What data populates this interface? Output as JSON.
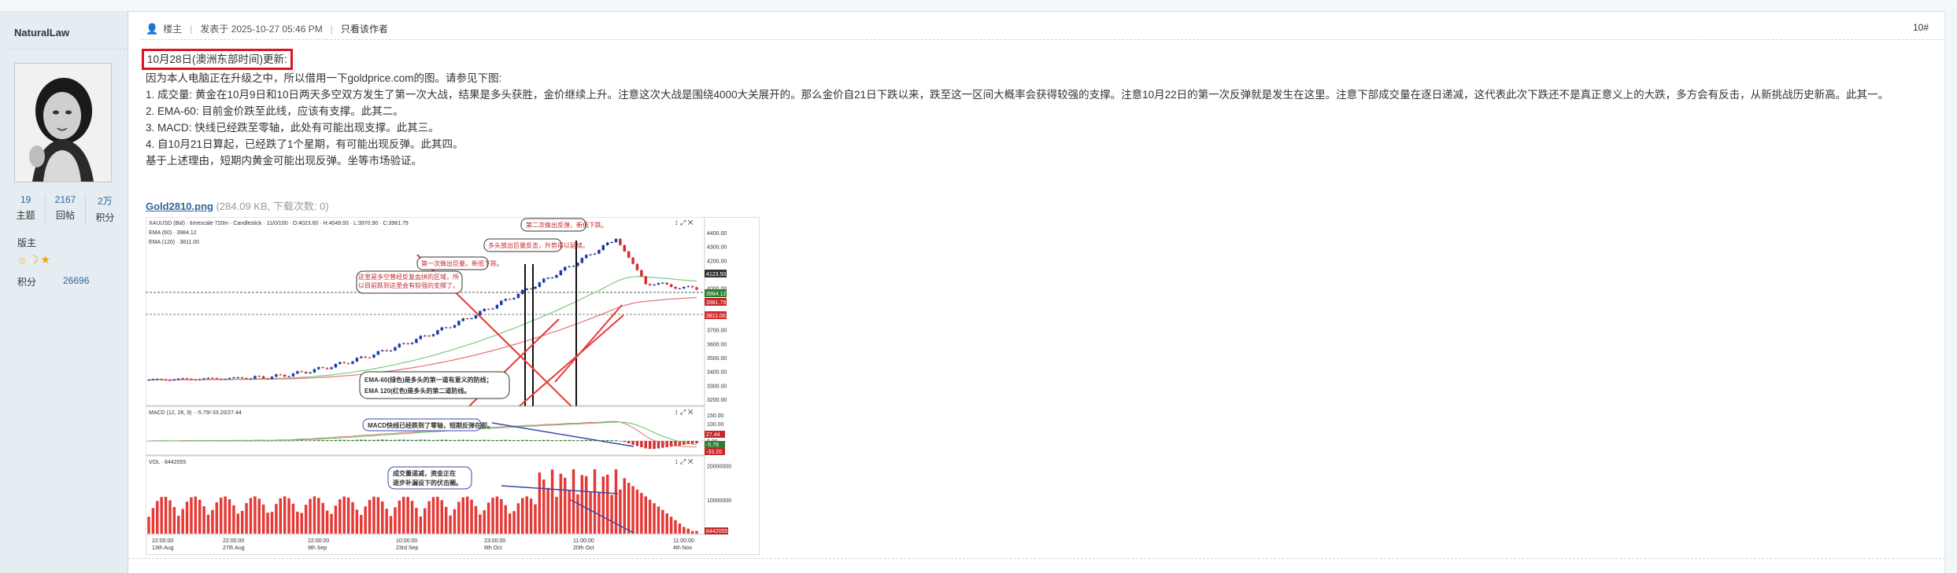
{
  "author": {
    "name": "NaturalLaw",
    "stats": [
      {
        "value": "19",
        "label": "主题"
      },
      {
        "value": "2167",
        "label": "回帖"
      },
      {
        "value": "2万",
        "label": "积分"
      }
    ],
    "group": "版主",
    "credit_label": "积分",
    "credit_value": "26696"
  },
  "post": {
    "owner_label": "楼主",
    "posted_at": "发表于 2025-10-27 05:46 PM",
    "only_author": "只看该作者",
    "floor": "10#",
    "heading": "10月28日(澳洲东部时间)更新:",
    "lines": [
      "因为本人电脑正在升级之中，所以借用一下goldprice.com的图。请参见下图:",
      "1. 成交量: 黄金在10月9日和10日两天多空双方发生了第一次大战，结果是多头获胜，金价继续上升。注意这次大战是围绕4000大关展开的。那么金价自21日下跌以来，跌至这一区间大概率会获得较强的支撑。注意10月22日的第一次反弹就是发生在这里。注意下部成交量在逐日递减，这代表此次下跌还不是真正意义上的大跌，多方会有反击，从新挑战历史新高。此其一。",
      "2. EMA-60: 目前金价跌至此线，应该有支撑。此其二。",
      "3. MACD: 快线已经跌至零轴，此处有可能出现支撑。此其三。",
      "4. 自10月21日算起，已经跌了1个星期，有可能出现反弹。此其四。",
      "基于上述理由，短期内黄金可能出现反弹。坐等市场验证。"
    ],
    "attachment": {
      "name": "Gold2810.png",
      "info": "(284.09 KB, 下载次数: 0)"
    }
  },
  "chart": {
    "header": "XAUUSD (Bid) · timescale 720m · Candlestick · 11/0/100 · O:4023.60 · H:4049.93 · L:3970.90 · C:3981.79",
    "ema60": "EMA (60) · 3984.12",
    "ema120": "EMA (120) · 3811.00",
    "macd_label": "MACD (12, 26, 9) · -5.79/-33.20/27.44",
    "vol_label": "VOL · 8442055",
    "price_ticks": [
      "4400.00",
      "4300.00",
      "4200.00",
      "4100.00",
      "4000.00",
      "3900.00",
      "3800.00",
      "3700.00",
      "3600.00",
      "3500.00",
      "3400.00",
      "3300.00",
      "3200.00"
    ],
    "tag_4123": "4123.50",
    "tag_3984": "3984.12",
    "tag_3981": "3981.79",
    "tag_3811": "3811.00",
    "macd_ticks": [
      "150.00",
      "100.00",
      "50.00",
      "0.00"
    ],
    "tag_27": "27.44",
    "tag_5": "-5.79",
    "tag_33": "-33.20",
    "vol_ticks": [
      "20000000",
      "10000000"
    ],
    "tag_vol": "8442055",
    "dates": [
      {
        "t": "22:00:00",
        "d": "13th Aug"
      },
      {
        "t": "22:00:00",
        "d": "27th Aug"
      },
      {
        "t": "22:00:00",
        "d": "9th Sep"
      },
      {
        "t": "10:00:00",
        "d": "23rd Sep"
      },
      {
        "t": "23:00:00",
        "d": "6th Oct"
      },
      {
        "t": "11:00:00",
        "d": "20th Oct"
      },
      {
        "t": "11:00:00",
        "d": "4th Nov"
      }
    ],
    "annotations": {
      "a1": "第二次做出反弹，新低下跌。",
      "a2": "多头放出巨量反击，升势得以延续。",
      "a3": "第一次做出巨量，新低下跌。",
      "a4": "这里是多空曾经反复血拼的区域，所以目前跌到这里会有较强的支撑了。",
      "a5a": "EMA-60(绿色)是多头的第一道有意义的防线；",
      "a5b": "EMA 120(红色)是多头的第二道防线。",
      "a6": "MACD快线已经跌到了零轴，短期反弹在即。",
      "a7a": "成交量递减，资金正在",
      "a7b": "逐步补漏设下的伏击圈。"
    }
  }
}
